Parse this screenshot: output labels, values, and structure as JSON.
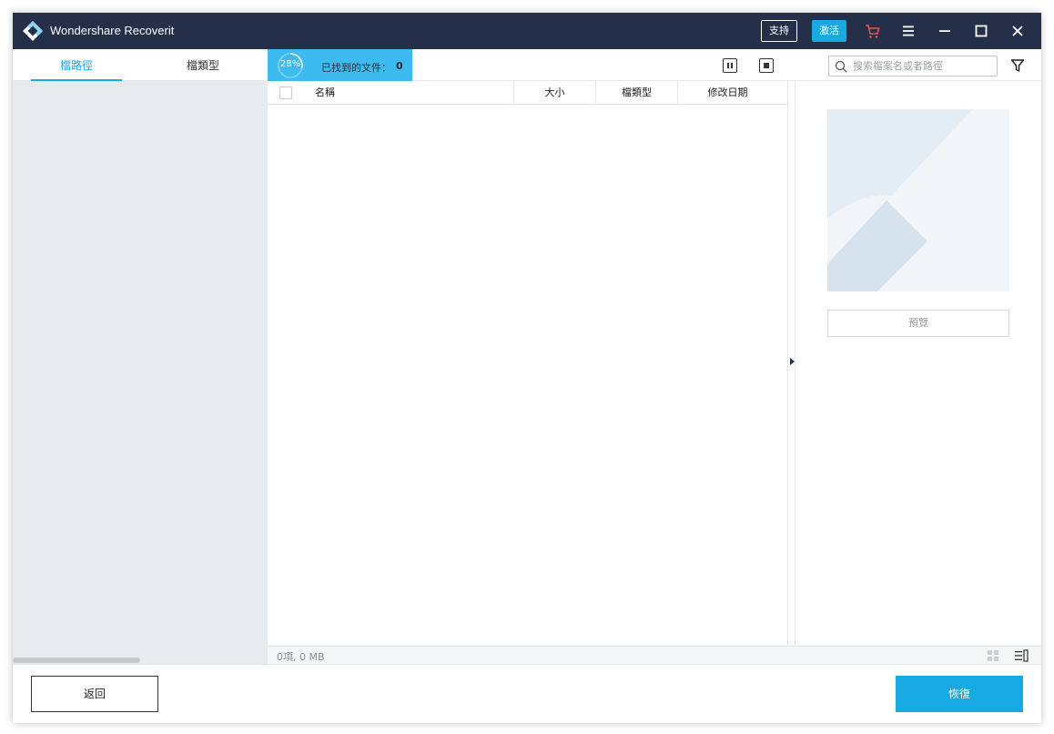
{
  "app": {
    "title": "Wondershare Recoverit"
  },
  "titlebar": {
    "support_label": "支持",
    "activate_label": "激活",
    "icons": [
      "cart-icon",
      "menu-icon",
      "minimize-icon",
      "maximize-icon",
      "close-icon"
    ]
  },
  "sidebar": {
    "tabs": [
      {
        "label": "檔路徑",
        "active": true
      },
      {
        "label": "檔類型",
        "active": false
      }
    ]
  },
  "scan": {
    "progress_percent": "28%",
    "progress_value": 0.28,
    "found_label": "已找到的文件：",
    "found_count": "0"
  },
  "search": {
    "placeholder": "搜索檔案名或者路徑",
    "value": ""
  },
  "file_list": {
    "columns": [
      "名稱",
      "大小",
      "檔類型",
      "修改日期"
    ],
    "rows": []
  },
  "preview": {
    "button_label": "預覽"
  },
  "status": {
    "summary": "0項, 0 MB"
  },
  "footer": {
    "back_label": "返回",
    "recover_label": "恢復"
  },
  "colors": {
    "titlebar": "#24304a",
    "accent": "#17a9e1",
    "progress_bg": "#3ebbee",
    "sidebar_bg": "#e8ebee"
  }
}
